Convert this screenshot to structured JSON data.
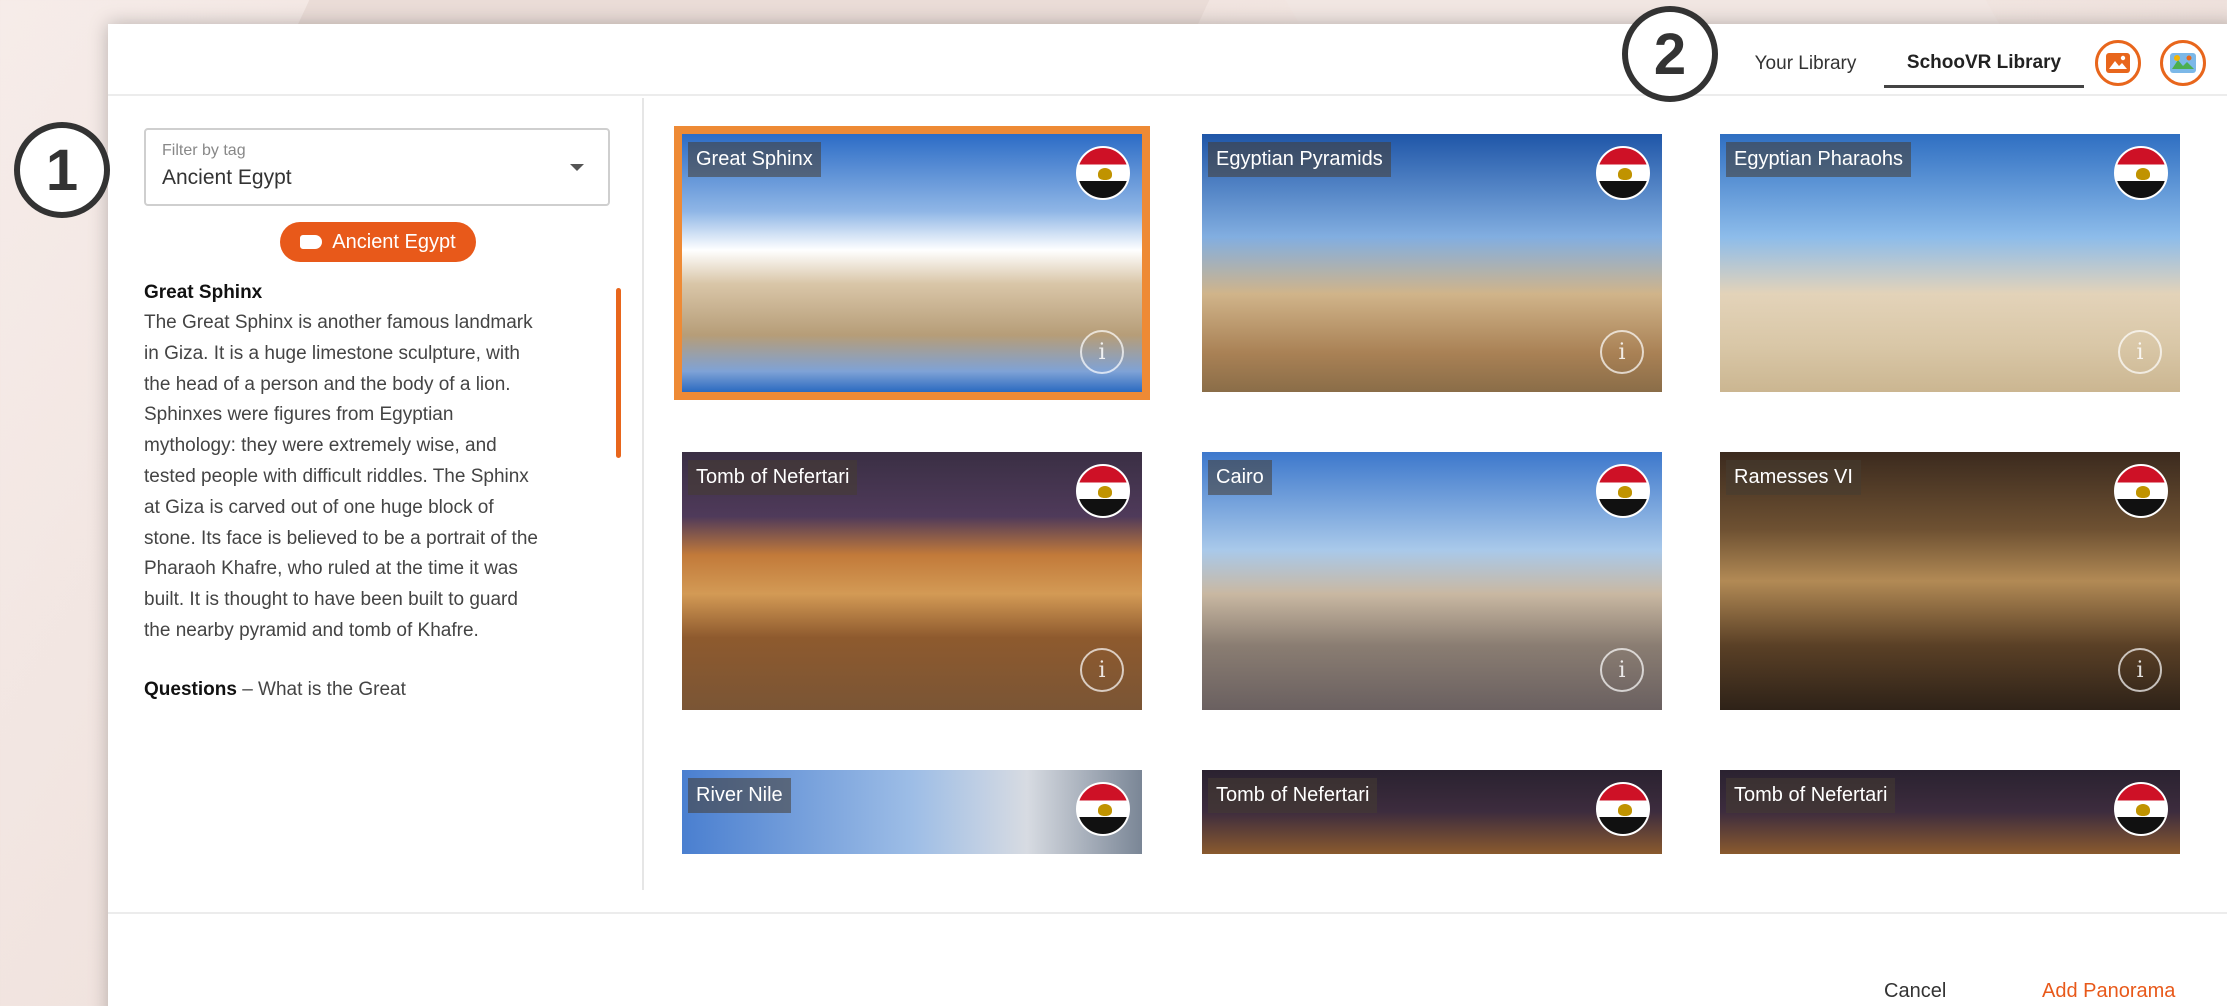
{
  "steps": {
    "step1": "1",
    "step2": "2"
  },
  "header": {
    "tabs": [
      {
        "label": "Your Library",
        "active": false
      },
      {
        "label": "SchooVR Library",
        "active": true
      }
    ],
    "icons": [
      "image-upload-icon",
      "map-image-icon"
    ]
  },
  "filter": {
    "label": "Filter by tag",
    "value": "Ancient Egypt",
    "chip": "Ancient Egypt"
  },
  "description": {
    "title": "Great Sphinx",
    "body": "The Great Sphinx is another famous landmark in Giza. It is a huge limestone sculpture, with the head of a person and the body of a lion. Sphinxes were figures from Egyptian mythology:  they were extremely wise, and tested people with difficult riddles. The Sphinx at Giza is carved out of one huge block of stone. Its face is believed to be a portrait of the Pharaoh Khafre, who ruled at the time it was built. It is thought to have been built to guard the nearby pyramid and tomb of Khafre.",
    "questions_label": "Questions",
    "questions_text": "What is the Great"
  },
  "panoramas": [
    {
      "title": "Great Sphinx",
      "selected": true
    },
    {
      "title": "Egyptian Pyramids",
      "selected": false
    },
    {
      "title": "Egyptian Pharaohs",
      "selected": false
    },
    {
      "title": "Tomb of Nefertari",
      "selected": false
    },
    {
      "title": "Cairo",
      "selected": false
    },
    {
      "title": "Ramesses VI",
      "selected": false
    },
    {
      "title": "River Nile",
      "selected": false
    },
    {
      "title": "Tomb of Nefertari",
      "selected": false
    },
    {
      "title": "Tomb of Nefertari",
      "selected": false
    }
  ],
  "footer": {
    "cancel": "Cancel",
    "add": "Add Panorama"
  },
  "colors": {
    "accent": "#e8591a",
    "selection": "#ee8a35"
  }
}
